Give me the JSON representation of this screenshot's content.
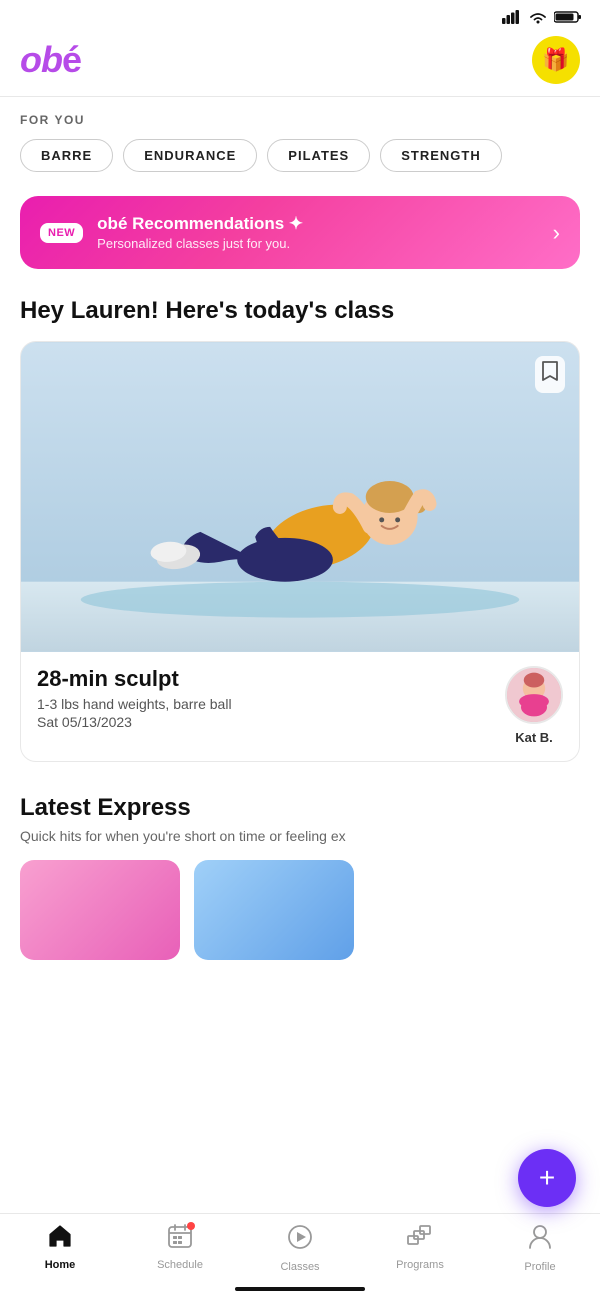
{
  "statusBar": {
    "signal": "▐▌▌▌",
    "wifi": "wifi",
    "battery": "battery"
  },
  "header": {
    "logo": "obé",
    "giftIcon": "🎁"
  },
  "forYou": {
    "label": "FOR YOU",
    "pills": [
      "BARRE",
      "ENDURANCE",
      "PILATES",
      "STRENGTH"
    ]
  },
  "recBanner": {
    "newLabel": "NEW",
    "title": "obé Recommendations ✦",
    "subtitle": "Personalized classes just for you.",
    "chevron": "›"
  },
  "todayClass": {
    "heading": "Hey Lauren! Here's today's class",
    "title": "28-min sculpt",
    "meta": "1-3 lbs hand weights, barre ball",
    "date": "Sat 05/13/2023",
    "instructorName": "Kat B.",
    "instructorEmoji": "👩"
  },
  "latestExpress": {
    "title": "Latest Express",
    "subtitle": "Quick hits for when you're short on time or feeling ex"
  },
  "fab": {
    "icon": "+"
  },
  "bottomNav": {
    "items": [
      {
        "id": "home",
        "label": "Home",
        "active": true
      },
      {
        "id": "schedule",
        "label": "Schedule",
        "active": false,
        "hasDot": true
      },
      {
        "id": "classes",
        "label": "Classes",
        "active": false
      },
      {
        "id": "programs",
        "label": "Programs",
        "active": false
      },
      {
        "id": "profile",
        "label": "Profile",
        "active": false
      }
    ]
  }
}
